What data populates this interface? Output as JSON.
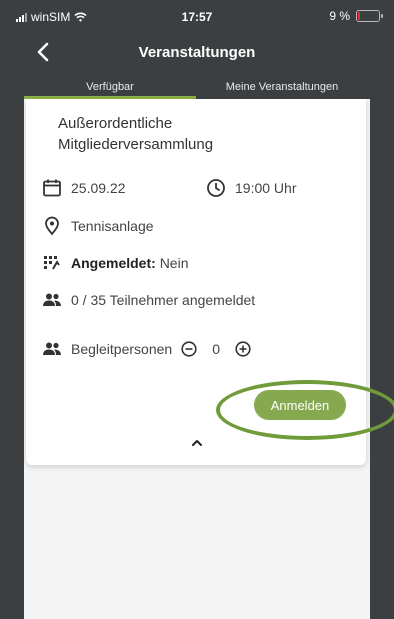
{
  "status_bar": {
    "carrier": "winSIM",
    "time": "17:57",
    "battery": "9 %"
  },
  "header": {
    "title": "Veranstaltungen",
    "back_icon": "chevron-left-icon"
  },
  "tabs": [
    {
      "label": "Verfügbar",
      "active": true
    },
    {
      "label": "Meine Veranstaltungen",
      "active": false
    }
  ],
  "event": {
    "title_line1": "Außerordentliche",
    "title_line2": "Mitgliederversammlung",
    "date": "25.09.22",
    "time": "19:00 Uhr",
    "location": "Tennisanlage",
    "registered_label": "Angemeldet:",
    "registered_value": "Nein",
    "participants": "0 / 35 Teilnehmer angemeldet",
    "companions_label": "Begleitpersonen",
    "companions_value": "0",
    "register_button": "Anmelden"
  },
  "colors": {
    "accent": "#86a84f",
    "highlight": "#6f9b3b",
    "background": "#3c3f41"
  }
}
